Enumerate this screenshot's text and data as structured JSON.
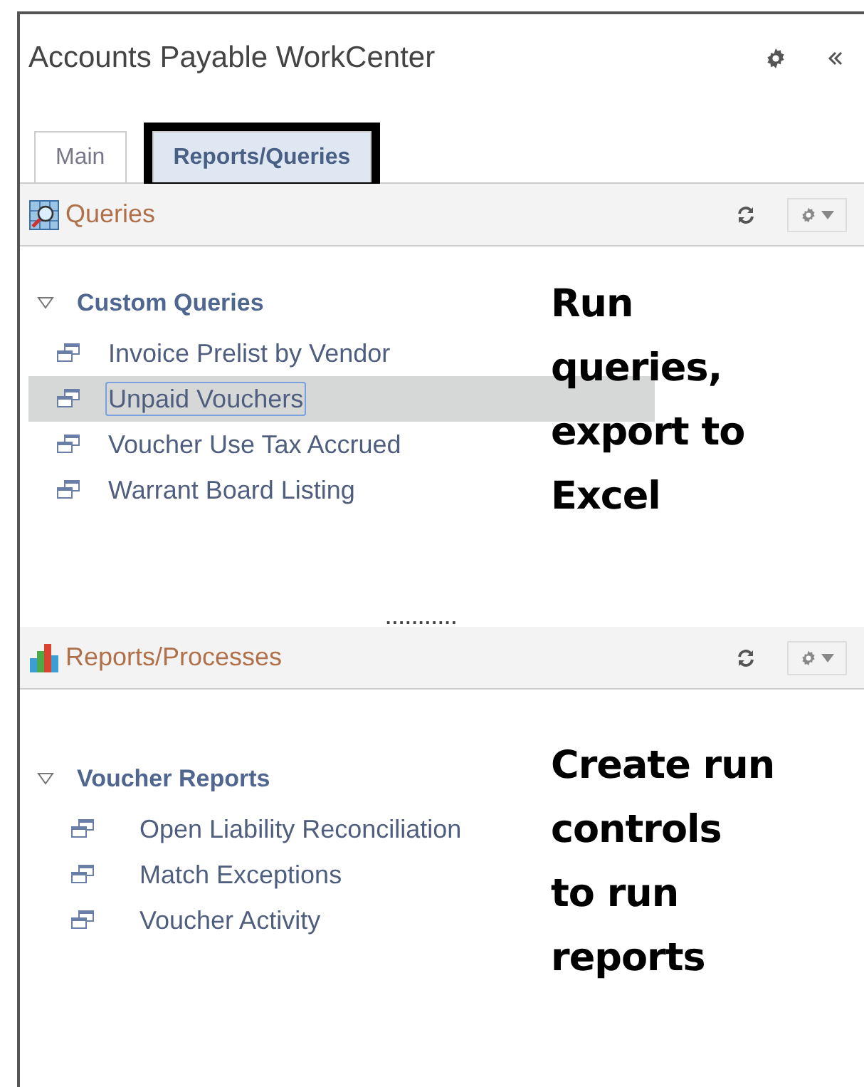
{
  "window": {
    "title": "Accounts Payable WorkCenter"
  },
  "tabs": [
    {
      "label": "Main",
      "selected": false
    },
    {
      "label": "Reports/Queries",
      "selected": true,
      "highlighted": true
    }
  ],
  "sections": [
    {
      "kind": "queries",
      "title": "Queries",
      "group": {
        "label": "Custom Queries",
        "expanded": true,
        "items": [
          {
            "label": "Invoice Prelist by Vendor",
            "selected": false
          },
          {
            "label": "Unpaid Vouchers",
            "selected": true
          },
          {
            "label": "Voucher Use Tax Accrued",
            "selected": false
          },
          {
            "label": "Warrant Board Listing",
            "selected": false
          }
        ]
      },
      "annotation": [
        "Run",
        "queries,",
        "export to",
        "Excel"
      ],
      "splitter": "..........."
    },
    {
      "kind": "reports",
      "title": "Reports/Processes",
      "group": {
        "label": "Voucher Reports",
        "expanded": true,
        "items": [
          {
            "label": "Open Liability Reconciliation",
            "selected": false
          },
          {
            "label": "Match Exceptions",
            "selected": false
          },
          {
            "label": "Voucher Activity",
            "selected": false
          }
        ]
      },
      "annotation": [
        "Create run",
        "controls",
        "to run",
        "reports"
      ]
    }
  ]
}
